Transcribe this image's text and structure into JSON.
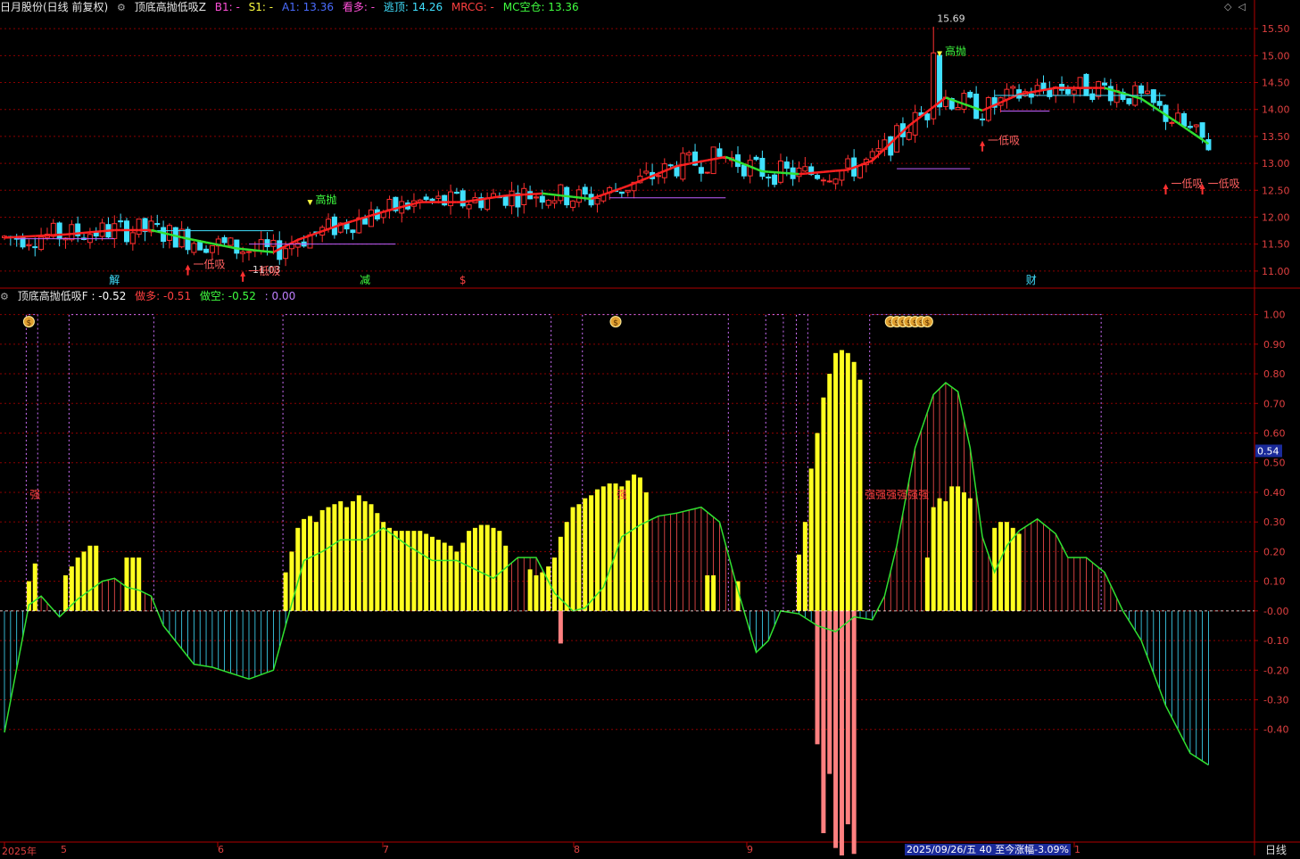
{
  "main_header": {
    "stock": "日月股份(日线 前复权)",
    "indicator": "顶底高抛低吸Z",
    "values": [
      {
        "text": "B1: -",
        "color": "#ff4fd8"
      },
      {
        "text": "S1: -",
        "color": "#ffff40"
      },
      {
        "text": "A1: 13.36",
        "color": "#4a6cff"
      },
      {
        "text": "看多: -",
        "color": "#ff4fd8"
      },
      {
        "text": "逃顶: 14.26",
        "color": "#40e0ff"
      },
      {
        "text": "MRCG: -",
        "color": "#ff4040"
      },
      {
        "text": "MC空仓: 13.36",
        "color": "#40ff40"
      }
    ]
  },
  "sub_header": {
    "indicator": "顶底高抛低吸F",
    "values": [
      {
        "text": ": -0.52",
        "color": "#ffffff"
      },
      {
        "text": "做多: -0.51",
        "color": "#ff4040"
      },
      {
        "text": "做空: -0.52",
        "color": "#40ff40"
      },
      {
        "text": ": 0.00",
        "color": "#c080ff"
      }
    ]
  },
  "bottom_axis": {
    "year": "2025年",
    "months": [
      "5",
      "6",
      "7",
      "8",
      "9",
      "1"
    ],
    "status": "2025/09/26/五 40 至今涨幅-3.09%",
    "period": "日线"
  },
  "current_value_tag": "0.54",
  "colors": {
    "up": "#ff3030",
    "down": "#40e0ff",
    "ma_up": "#ff2020",
    "ma_down": "#30e030",
    "grid": "#8b0000"
  },
  "chart_data": [
    {
      "type": "candlestick",
      "title": "顶底高抛低吸Z",
      "ylim": [
        10.7,
        15.8
      ],
      "y_ticks": [
        11.0,
        11.5,
        12.0,
        12.5,
        13.0,
        13.5,
        14.0,
        14.5,
        15.0,
        15.5
      ],
      "y_tick_labels": [
        "11.00",
        "11.50",
        "12.00",
        "12.50",
        "13.00",
        "13.50",
        "14.00",
        "14.50",
        "15.00",
        "15.50"
      ],
      "annotations": [
        {
          "text": "15.69",
          "bar": 152,
          "value": 15.69,
          "color": "#dddddd"
        },
        {
          "text": "11.03",
          "bar": 40,
          "value": 11.03,
          "color": "#dddddd"
        },
        {
          "text": "高抛",
          "bar": 50,
          "value": 12.32,
          "color": "#40ff40"
        },
        {
          "text": "高抛",
          "bar": 153,
          "value": 15.08,
          "color": "#40ff40"
        },
        {
          "text": "低吸",
          "bar": 30,
          "value": 11.12,
          "color": "#ff6060"
        },
        {
          "text": "低吸",
          "bar": 39,
          "value": 11.0,
          "color": "#ff6060"
        },
        {
          "text": "低吸",
          "bar": 160,
          "value": 13.42,
          "color": "#ff6060"
        },
        {
          "text": "低吸",
          "bar": 190,
          "value": 12.62,
          "color": "#ff6060"
        },
        {
          "text": "低吸",
          "bar": 196,
          "value": 12.62,
          "color": "#ff6060"
        }
      ],
      "markers": [
        {
          "text": "解",
          "bar": 18,
          "color": "#40e0ff"
        },
        {
          "text": "减",
          "bar": 59,
          "color": "#40ff40"
        },
        {
          "text": "$",
          "bar": 75,
          "color": "#ff4040"
        },
        {
          "text": "财",
          "bar": 168,
          "color": "#40e0ff"
        }
      ],
      "series": [
        {
          "name": "高抛低吸线",
          "values_points": [
            [
              0,
              11.62
            ],
            [
              10,
              11.68
            ],
            [
              18,
              11.76
            ],
            [
              24,
              11.76
            ],
            [
              30,
              11.6
            ],
            [
              38,
              11.42
            ],
            [
              44,
              11.35
            ],
            [
              48,
              11.58
            ],
            [
              55,
              11.86
            ],
            [
              62,
              12.1
            ],
            [
              68,
              12.28
            ],
            [
              75,
              12.28
            ],
            [
              82,
              12.4
            ],
            [
              88,
              12.44
            ],
            [
              96,
              12.34
            ],
            [
              102,
              12.58
            ],
            [
              110,
              12.95
            ],
            [
              118,
              13.12
            ],
            [
              124,
              12.85
            ],
            [
              130,
              12.8
            ],
            [
              138,
              12.88
            ],
            [
              142,
              13.05
            ],
            [
              148,
              13.7
            ],
            [
              154,
              14.22
            ],
            [
              160,
              13.98
            ],
            [
              166,
              14.28
            ],
            [
              172,
              14.4
            ],
            [
              180,
              14.4
            ],
            [
              186,
              14.2
            ],
            [
              192,
              13.75
            ],
            [
              197,
              13.36
            ]
          ]
        }
      ]
    },
    {
      "type": "oscillator",
      "title": "顶底高抛低吸F",
      "ylim": [
        -0.78,
        1.05
      ],
      "y_ticks": [
        1.0,
        0.9,
        0.8,
        0.7,
        0.6,
        0.5,
        0.4,
        0.3,
        0.2,
        0.1,
        0.0,
        -0.1,
        -0.2,
        -0.3,
        -0.4
      ],
      "y_tick_labels": [
        "1.00",
        "0.90",
        "0.80",
        "0.70",
        "0.60",
        "0.50",
        "0.40",
        "0.30",
        "0.20",
        "0.10",
        "-0.00",
        "-0.10",
        "-0.20",
        "-0.30",
        "-0.40"
      ],
      "labels": [
        {
          "text": "强",
          "bar": 5,
          "value": 0.38,
          "color": "#ff4040"
        },
        {
          "text": "强",
          "bar": 101,
          "value": 0.38,
          "color": "#ff4040"
        },
        {
          "text": "强强强强强强",
          "bar": 146,
          "value": 0.38,
          "color": "#ff4040"
        }
      ],
      "money_icons": [
        4,
        100,
        145,
        146,
        147,
        148,
        149,
        150,
        151
      ],
      "gate_segments": [
        [
          4,
          5
        ],
        [
          11,
          24
        ],
        [
          46,
          89
        ],
        [
          95,
          118
        ],
        [
          125,
          127
        ],
        [
          130,
          131
        ],
        [
          142,
          179
        ]
      ],
      "osc_points": [
        [
          0,
          -0.41
        ],
        [
          4,
          0.02
        ],
        [
          6,
          0.05
        ],
        [
          9,
          -0.02
        ],
        [
          12,
          0.04
        ],
        [
          16,
          0.1
        ],
        [
          18,
          0.11
        ],
        [
          20,
          0.08
        ],
        [
          22,
          0.07
        ],
        [
          24,
          0.05
        ],
        [
          26,
          -0.05
        ],
        [
          31,
          -0.18
        ],
        [
          34,
          -0.19
        ],
        [
          37,
          -0.21
        ],
        [
          40,
          -0.23
        ],
        [
          44,
          -0.2
        ],
        [
          46,
          -0.05
        ],
        [
          49,
          0.17
        ],
        [
          52,
          0.2
        ],
        [
          55,
          0.24
        ],
        [
          59,
          0.24
        ],
        [
          62,
          0.28
        ],
        [
          66,
          0.22
        ],
        [
          70,
          0.17
        ],
        [
          74,
          0.17
        ],
        [
          77,
          0.14
        ],
        [
          80,
          0.11
        ],
        [
          84,
          0.18
        ],
        [
          87,
          0.18
        ],
        [
          90,
          0.06
        ],
        [
          93,
          0.0
        ],
        [
          95,
          0.01
        ],
        [
          98,
          0.08
        ],
        [
          101,
          0.25
        ],
        [
          104,
          0.29
        ],
        [
          107,
          0.32
        ],
        [
          110,
          0.33
        ],
        [
          114,
          0.35
        ],
        [
          117,
          0.3
        ],
        [
          120,
          0.07
        ],
        [
          123,
          -0.14
        ],
        [
          125,
          -0.1
        ],
        [
          127,
          0.0
        ],
        [
          130,
          -0.01
        ],
        [
          133,
          -0.05
        ],
        [
          136,
          -0.07
        ],
        [
          139,
          -0.02
        ],
        [
          142,
          -0.03
        ],
        [
          144,
          0.05
        ],
        [
          146,
          0.22
        ],
        [
          149,
          0.55
        ],
        [
          152,
          0.73
        ],
        [
          154,
          0.77
        ],
        [
          156,
          0.74
        ],
        [
          158,
          0.55
        ],
        [
          160,
          0.25
        ],
        [
          162,
          0.13
        ],
        [
          164,
          0.22
        ],
        [
          166,
          0.27
        ],
        [
          169,
          0.31
        ],
        [
          172,
          0.26
        ],
        [
          174,
          0.18
        ],
        [
          177,
          0.18
        ],
        [
          180,
          0.13
        ],
        [
          183,
          0.0
        ],
        [
          186,
          -0.1
        ],
        [
          190,
          -0.32
        ],
        [
          194,
          -0.48
        ],
        [
          197,
          -0.52
        ]
      ],
      "yellow_bars": [
        [
          4,
          0.1
        ],
        [
          5,
          0.16
        ],
        [
          10,
          0.12
        ],
        [
          11,
          0.15
        ],
        [
          12,
          0.18
        ],
        [
          13,
          0.2
        ],
        [
          14,
          0.22
        ],
        [
          15,
          0.22
        ],
        [
          20,
          0.18
        ],
        [
          21,
          0.18
        ],
        [
          22,
          0.18
        ],
        [
          46,
          0.13
        ],
        [
          47,
          0.2
        ],
        [
          48,
          0.28
        ],
        [
          49,
          0.31
        ],
        [
          50,
          0.32
        ],
        [
          51,
          0.3
        ],
        [
          52,
          0.34
        ],
        [
          53,
          0.35
        ],
        [
          54,
          0.36
        ],
        [
          55,
          0.37
        ],
        [
          56,
          0.35
        ],
        [
          57,
          0.37
        ],
        [
          58,
          0.39
        ],
        [
          59,
          0.37
        ],
        [
          60,
          0.36
        ],
        [
          61,
          0.33
        ],
        [
          62,
          0.3
        ],
        [
          63,
          0.28
        ],
        [
          64,
          0.27
        ],
        [
          65,
          0.27
        ],
        [
          66,
          0.27
        ],
        [
          67,
          0.27
        ],
        [
          68,
          0.27
        ],
        [
          69,
          0.26
        ],
        [
          70,
          0.25
        ],
        [
          71,
          0.24
        ],
        [
          72,
          0.23
        ],
        [
          73,
          0.22
        ],
        [
          74,
          0.2
        ],
        [
          75,
          0.23
        ],
        [
          76,
          0.27
        ],
        [
          77,
          0.28
        ],
        [
          78,
          0.29
        ],
        [
          79,
          0.29
        ],
        [
          80,
          0.28
        ],
        [
          81,
          0.27
        ],
        [
          82,
          0.22
        ],
        [
          86,
          0.14
        ],
        [
          87,
          0.12
        ],
        [
          88,
          0.13
        ],
        [
          89,
          0.15
        ],
        [
          90,
          0.18
        ],
        [
          91,
          0.25
        ],
        [
          92,
          0.3
        ],
        [
          93,
          0.35
        ],
        [
          94,
          0.36
        ],
        [
          95,
          0.38
        ],
        [
          96,
          0.39
        ],
        [
          97,
          0.41
        ],
        [
          98,
          0.42
        ],
        [
          99,
          0.43
        ],
        [
          100,
          0.43
        ],
        [
          101,
          0.42
        ],
        [
          102,
          0.44
        ],
        [
          103,
          0.46
        ],
        [
          104,
          0.45
        ],
        [
          105,
          0.4
        ],
        [
          115,
          0.12
        ],
        [
          116,
          0.12
        ],
        [
          120,
          0.1
        ],
        [
          130,
          0.19
        ],
        [
          131,
          0.3
        ],
        [
          132,
          0.48
        ],
        [
          133,
          0.6
        ],
        [
          134,
          0.72
        ],
        [
          135,
          0.8
        ],
        [
          136,
          0.87
        ],
        [
          137,
          0.88
        ],
        [
          138,
          0.87
        ],
        [
          139,
          0.84
        ],
        [
          140,
          0.78
        ],
        [
          151,
          0.18
        ],
        [
          152,
          0.35
        ],
        [
          153,
          0.38
        ],
        [
          154,
          0.37
        ],
        [
          155,
          0.42
        ],
        [
          156,
          0.42
        ],
        [
          157,
          0.4
        ],
        [
          158,
          0.38
        ],
        [
          162,
          0.28
        ],
        [
          163,
          0.3
        ],
        [
          164,
          0.3
        ],
        [
          165,
          0.28
        ],
        [
          166,
          0.26
        ]
      ],
      "pink_bars": [
        [
          91,
          -0.11
        ],
        [
          133,
          -0.45
        ],
        [
          134,
          -0.75
        ],
        [
          135,
          -0.55
        ],
        [
          136,
          -0.8
        ],
        [
          137,
          -0.93
        ],
        [
          138,
          -0.72
        ],
        [
          139,
          -0.82
        ]
      ]
    }
  ]
}
